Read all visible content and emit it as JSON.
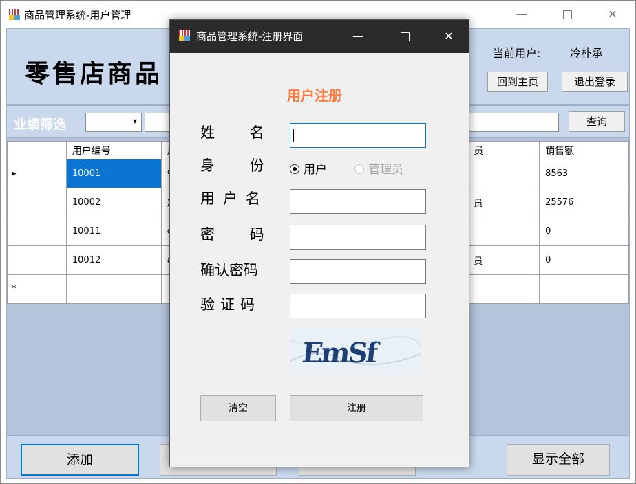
{
  "main_window": {
    "title": "商品管理系统-用户管理",
    "controls": {
      "minimize": "—",
      "close": "✕"
    }
  },
  "header": {
    "store_title": "零售店商品",
    "current_user_label": "当前用户:",
    "current_user_name": "冷朴承",
    "home_button": "回到主页",
    "logout_button": "退出登录"
  },
  "filter": {
    "label": "业绩筛选",
    "select_value": "",
    "select_arrow": "▾",
    "search_value": "",
    "query_button": "查询"
  },
  "table": {
    "columns": [
      {
        "key": "id",
        "label": "用户编号"
      },
      {
        "key": "name",
        "label": "用"
      },
      {
        "key": "role",
        "label": "员"
      },
      {
        "key": "sales",
        "label": "销售额"
      }
    ],
    "rows": [
      {
        "id": "10001",
        "name": "管",
        "role": "",
        "sales": "8563",
        "current": true
      },
      {
        "id": "10002",
        "name": "冷",
        "role": "员",
        "sales": "25576"
      },
      {
        "id": "10011",
        "name": "d",
        "role": "",
        "sales": "0"
      },
      {
        "id": "10012",
        "name": "a",
        "role": "员",
        "sales": "0"
      }
    ],
    "current_row_marker": "▸",
    "new_row_marker": "*"
  },
  "bottom": {
    "add_button": "添加",
    "show_all_button": "显示全部"
  },
  "dialog": {
    "title": "商品管理系统-注册界面",
    "controls": {
      "minimize": "—",
      "close": "✕"
    },
    "header": "用户注册",
    "labels": {
      "name": "姓 名",
      "role": "身 份",
      "username": "用户名",
      "password": "密 码",
      "confirm": "确认密码",
      "captcha": "验证码"
    },
    "fields": {
      "name": "",
      "username": "",
      "password": "",
      "confirm": "",
      "captcha": ""
    },
    "role_options": [
      {
        "label": "用户",
        "selected": true
      },
      {
        "label": "管理员",
        "selected": false,
        "disabled": true
      }
    ],
    "captcha_text": "EmSf",
    "clear_button": "清空",
    "register_button": "注册"
  },
  "colors": {
    "panel_blue": "#c9d8ec",
    "grid_bg": "#b4c4db",
    "selection": "#0b75d3",
    "dialog_title": "#2b2b2b",
    "register_header": "#ff7a3c",
    "focus_border": "#0078d7"
  },
  "icons": {
    "app": "app-icon",
    "minimize": "minimize-icon",
    "maximize": "maximize-icon",
    "close": "close-icon"
  }
}
